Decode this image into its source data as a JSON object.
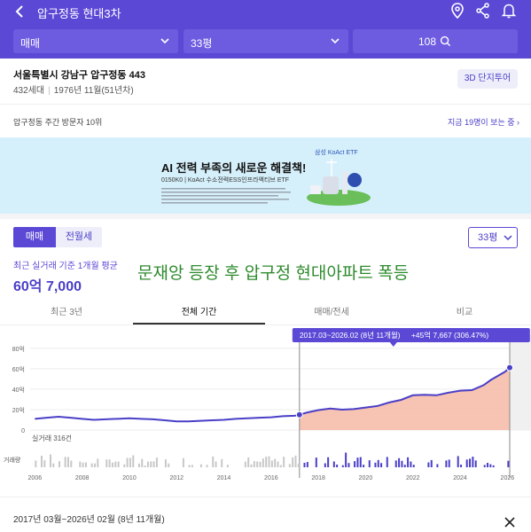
{
  "header": {
    "title": "압구정동 현대3차",
    "filters": {
      "trade_type": "매매",
      "size": "33평",
      "count": "108"
    }
  },
  "property": {
    "address": "서울특별시 강남구 압구정동 443",
    "households": "432세대",
    "built": "1976년 11월(51년차)",
    "tour_button": "3D 단지투어"
  },
  "visitors": {
    "rank": "압구정동 주간 방문자 10위",
    "viewing_now": "지금 19명이 보는 중"
  },
  "ad": {
    "brand": "삼성 KoAct ETF",
    "headline": "AI 전력 부족의 새로운 해결책!",
    "subline": "0150K0 | KoAct 수소전력ESS인프라액티브 ETF"
  },
  "trade_tabs": [
    "매매",
    "전월세"
  ],
  "size_select": "33평",
  "summary": {
    "label": "최근 실거래 기준 1개월 평균",
    "price": "60억 7,000"
  },
  "overlay_text": "문재앙 등장 후 압구정 현대아파트 폭등",
  "period_tabs": [
    "최근 3년",
    "전체 기간",
    "매매/전세",
    "비교"
  ],
  "period_tabs_active": 1,
  "chart_data": {
    "type": "line",
    "x_ticks": [
      "2006",
      "2008",
      "2010",
      "2012",
      "2014",
      "2016",
      "2018",
      "2020",
      "2022",
      "2024",
      "2026"
    ],
    "y_ticks": [
      "0",
      "20억",
      "40억",
      "60억",
      "80억"
    ],
    "ylim": [
      0,
      85
    ],
    "xlim": [
      2005.8,
      2027.0
    ],
    "series": [
      {
        "x": [
          2006.0,
          2006.5,
          2007.0,
          2007.5,
          2008.0,
          2008.5,
          2009.0,
          2009.5,
          2010.0,
          2010.5,
          2011.0,
          2011.5,
          2012.0,
          2012.5,
          2013.0,
          2013.5,
          2014.0,
          2014.5,
          2015.0,
          2015.5,
          2016.0,
          2016.5,
          2017.0,
          2017.2,
          2017.5,
          2018.0,
          2018.5,
          2019.0,
          2019.5,
          2020.0,
          2020.5,
          2021.0,
          2021.5,
          2022.0,
          2022.5,
          2023.0,
          2023.5,
          2024.0,
          2024.5,
          2025.0,
          2025.3,
          2025.6,
          2025.9,
          2026.1
        ],
        "values": [
          11,
          12,
          13,
          12,
          11,
          10,
          10.5,
          11,
          11.5,
          11,
          10.5,
          9.5,
          8.5,
          8.5,
          9,
          9.5,
          10,
          11,
          11.5,
          12,
          12.5,
          13.5,
          14,
          15,
          17,
          19.5,
          21,
          20,
          20.5,
          22,
          23.5,
          27,
          29.5,
          34,
          34.5,
          34,
          36.5,
          38.5,
          39,
          44,
          49,
          53,
          57,
          61
        ]
      }
    ],
    "highlight_start": "2017.03",
    "highlight_end": "2026.02",
    "tooltip": "2017.03~2026.02 (8년 11개월)",
    "tooltip_change": "+45억 7,667 (306.47%)",
    "trade_count_label": "실거래 316건",
    "volume_label": "거래량",
    "volume_note": "bars show monthly trade volume"
  },
  "selection": {
    "period": "2017년 03월~2026년 02월 (8년 11개월)"
  },
  "colors": {
    "brand": "#5b49d6",
    "line": "#4a3fc7",
    "area": "#f6b9a6",
    "overlay": "#2e8b2e"
  }
}
